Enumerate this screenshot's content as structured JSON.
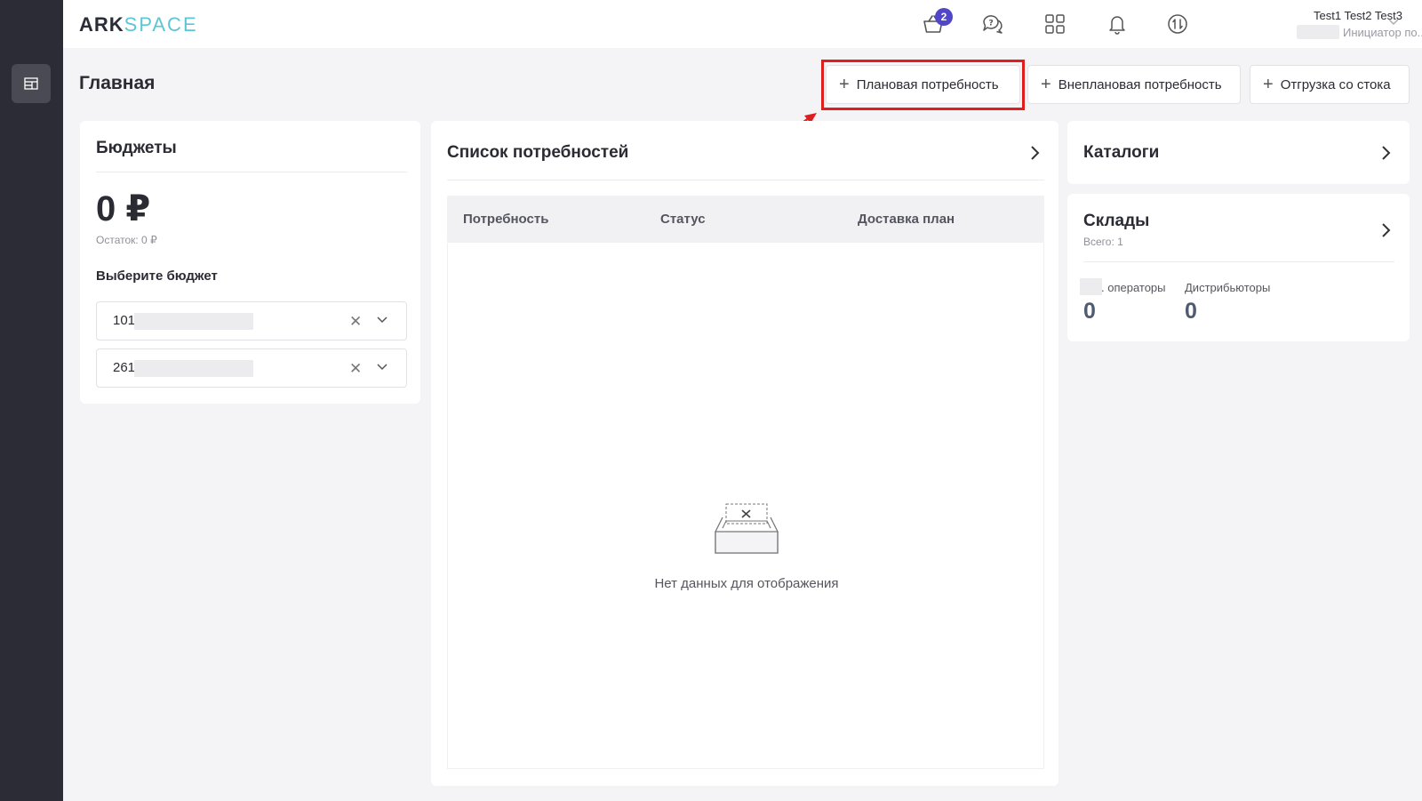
{
  "sidebar": {
    "items": [
      {
        "icon": "dashboard-icon",
        "active": true
      }
    ]
  },
  "header": {
    "logo": {
      "part1": "ARK",
      "part2": "SPACE"
    },
    "cart_badge": "2",
    "user": {
      "name": "Test1 Test2 Test3",
      "role": "Инициатор по..."
    }
  },
  "page": {
    "title": "Главная",
    "actions": {
      "planned": "Плановая потребность",
      "unplanned": "Внеплановая потребность",
      "stock_shipment": "Отгрузка со стока"
    }
  },
  "budgets": {
    "title": "Бюджеты",
    "amount": "0 ₽",
    "remainder": "Остаток: 0 ₽",
    "select_label": "Выберите бюджет",
    "selects": [
      {
        "value": "101"
      },
      {
        "value": "261"
      }
    ]
  },
  "needs": {
    "title": "Список потребностей",
    "columns": [
      "Потребность",
      "Статус",
      "Доставка план"
    ],
    "empty_text": "Нет данных для отображения"
  },
  "catalogs": {
    "title": "Каталоги"
  },
  "warehouses": {
    "title": "Склады",
    "total": "Всего: 1",
    "stats": [
      {
        "label": ". операторы",
        "value": "0"
      },
      {
        "label": "Дистрибьюторы",
        "value": "0"
      }
    ]
  },
  "colors": {
    "sidebar_bg": "#2c2c36",
    "accent": "#5146c8",
    "logo_accent": "#5bc6d6",
    "highlight": "#e01e1e"
  }
}
